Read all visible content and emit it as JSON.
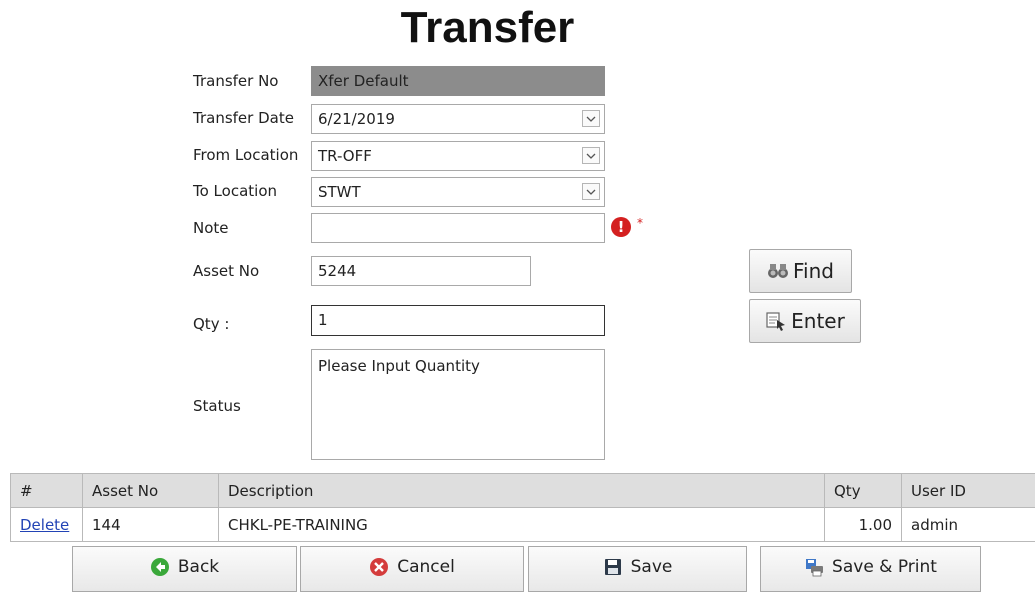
{
  "page": {
    "title": "Transfer"
  },
  "form": {
    "transfer_no": {
      "label": "Transfer No",
      "value": "Xfer Default"
    },
    "transfer_date": {
      "label": "Transfer Date",
      "value": "6/21/2019"
    },
    "from_location": {
      "label": "From Location",
      "value": "TR-OFF"
    },
    "to_location": {
      "label": "To Location",
      "value": "STWT"
    },
    "note": {
      "label": "Note",
      "value": "",
      "required_mark": "*",
      "error_icon": "!"
    },
    "asset_no": {
      "label": "Asset No",
      "value": "5244"
    },
    "qty": {
      "label": "Qty :",
      "value": "1"
    },
    "status": {
      "label": "Status",
      "value": "Please Input Quantity"
    }
  },
  "side_buttons": {
    "find": "Find",
    "enter": "Enter"
  },
  "grid": {
    "columns": [
      "#",
      "Asset No",
      "Description",
      "Qty",
      "User ID"
    ],
    "rows": [
      {
        "action": "Delete",
        "asset_no": "144",
        "description": "CHKL-PE-TRAINING",
        "qty": "1.00",
        "user_id": "admin"
      }
    ]
  },
  "footer_buttons": {
    "back": "Back",
    "cancel": "Cancel",
    "save": "Save",
    "save_print": "Save & Print"
  },
  "colors": {
    "error": "#d42020",
    "link": "#2243b5",
    "readonly_bg": "#8c8c8c",
    "back_icon": "#3aa83a"
  }
}
